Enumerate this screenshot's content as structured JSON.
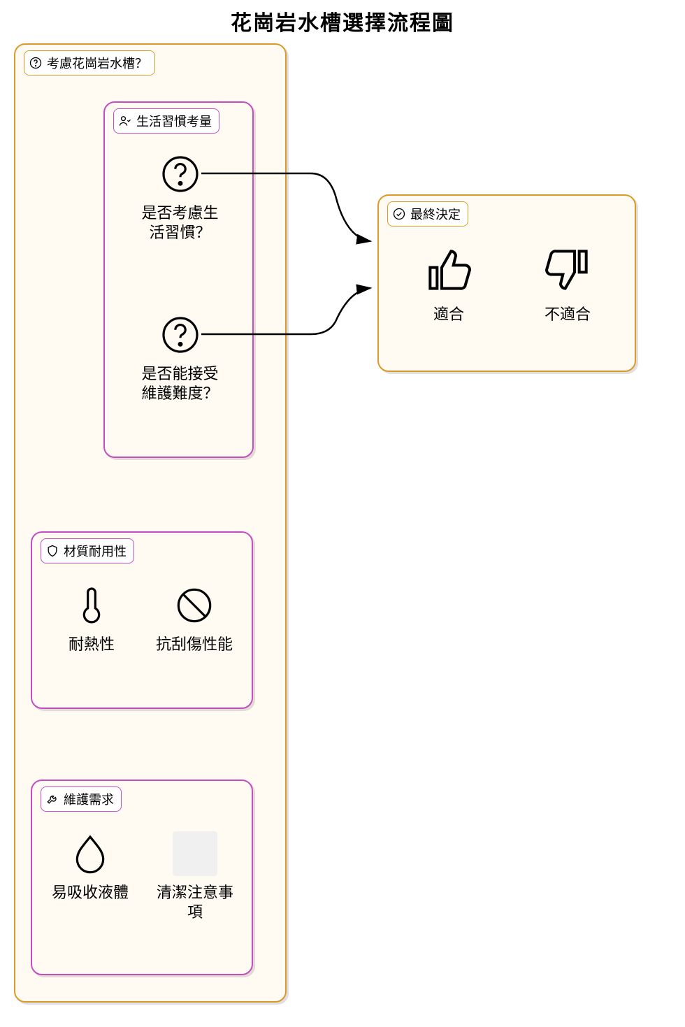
{
  "title": "花崗岩水槽選擇流程圖",
  "outer": {
    "label": "考慮花崗岩水槽？"
  },
  "lifestyle": {
    "label": "生活習慣考量",
    "q1": "是否考慮生活習慣？",
    "q2": "是否能接受維護難度？"
  },
  "durability": {
    "label": "材質耐用性",
    "item1": "耐熱性",
    "item2": "抗刮傷性能"
  },
  "maintenance": {
    "label": "維護需求",
    "item1": "易吸收液體",
    "item2": "清潔注意事項"
  },
  "decision": {
    "label": "最終決定",
    "yes": "適合",
    "no": "不適合"
  }
}
